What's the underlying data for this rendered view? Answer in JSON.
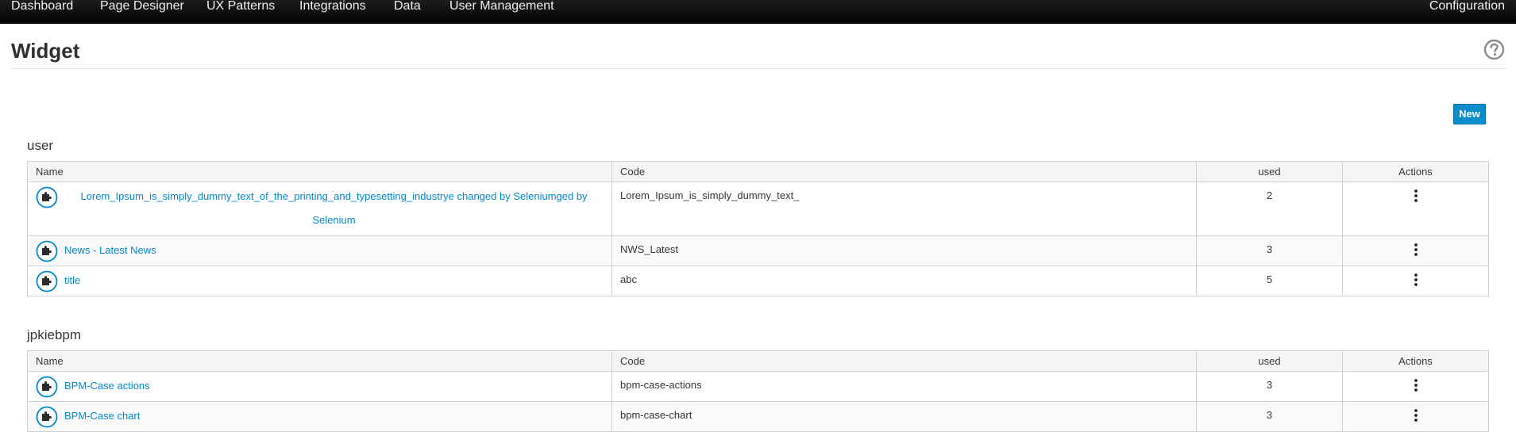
{
  "nav": {
    "items": [
      "Dashboard",
      "Page Designer",
      "UX Patterns",
      "Integrations",
      "Data",
      "User Management"
    ],
    "right": "Configuration"
  },
  "page": {
    "title": "Widget",
    "help_icon": "question-circle-icon"
  },
  "toolbar": {
    "new_label": "New"
  },
  "columns": {
    "name": "Name",
    "code": "Code",
    "used": "used",
    "actions": "Actions"
  },
  "groups": [
    {
      "title": "user",
      "rows": [
        {
          "name": "Lorem_Ipsum_is_simply_dummy_text_of_the_printing_and_typesetting_industrye changed by Seleniumged by Selenium",
          "code": "Lorem_Ipsum_is_simply_dummy_text_",
          "used": "2"
        },
        {
          "name": "News - Latest News",
          "code": "NWS_Latest",
          "used": "3"
        },
        {
          "name": "title",
          "code": "abc",
          "used": "5"
        }
      ]
    },
    {
      "title": "jpkiebpm",
      "rows": [
        {
          "name": "BPM-Case actions",
          "code": "bpm-case-actions",
          "used": "3"
        },
        {
          "name": "BPM-Case chart",
          "code": "bpm-case-chart",
          "used": "3"
        }
      ]
    }
  ],
  "icons": {
    "widget": "puzzle-piece-icon",
    "actions": "kebab-menu-icon"
  },
  "colors": {
    "link": "#0088ce",
    "primary_button": "#0a8dcc",
    "navbar": "#0a0a0a"
  }
}
